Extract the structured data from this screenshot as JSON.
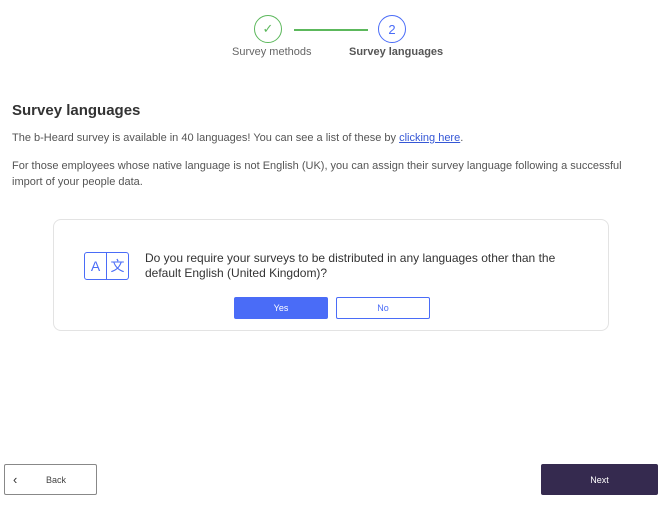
{
  "stepper": {
    "step1": {
      "label": "Survey methods",
      "icon": "check-icon",
      "glyph": "✓",
      "color": "#5cb85c"
    },
    "step2": {
      "label": "Survey languages",
      "number": "2",
      "color": "#4a6cf7"
    }
  },
  "main": {
    "title": "Survey languages",
    "p1_text": "The b-Heard survey is available in 40 languages! You can see a list of these by ",
    "p1_link": "clicking here",
    "p1_end": ".",
    "p2": "For those employees whose native language is not English (UK), you can assign their survey language following a successful import of your people data."
  },
  "card": {
    "icon": "translate-icon",
    "icon_left": "A",
    "icon_right": "文",
    "question": "Do you require your surveys to be distributed in any languages other than the default English (United Kingdom)?",
    "yes_label": "Yes",
    "no_label": "No"
  },
  "footer": {
    "back_icon": "chevron-left-icon",
    "back_glyph": "‹",
    "back_label": "Back",
    "next_label": "Next"
  },
  "colors": {
    "accent": "#4a6cf7",
    "success": "#5cb85c",
    "primary_dark": "#352a4f"
  }
}
